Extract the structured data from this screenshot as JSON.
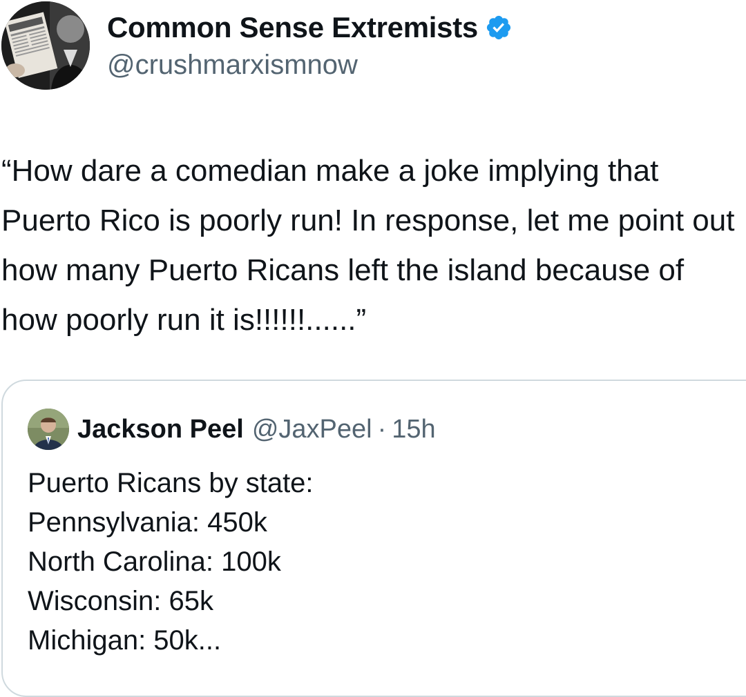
{
  "author": {
    "display_name": "Common Sense Extremists",
    "handle": "@crushmarxismnow",
    "verified_icon": "verified-badge-icon",
    "verified_color": "#1d9bf0"
  },
  "tweet": {
    "text": "“How dare a comedian make a joke implying that Puerto Rico is poorly run! In response, let me point out how many Puerto Ricans left the island because of how poorly run it is!!!!!!......”"
  },
  "quoted_tweet": {
    "display_name": "Jackson Peel",
    "handle": "@JaxPeel",
    "separator": "·",
    "time": "15h",
    "lines": [
      "Puerto Ricans by state:",
      "Pennsylvania: 450k",
      "North Carolina: 100k",
      "Wisconsin: 65k",
      "Michigan: 50k..."
    ]
  }
}
